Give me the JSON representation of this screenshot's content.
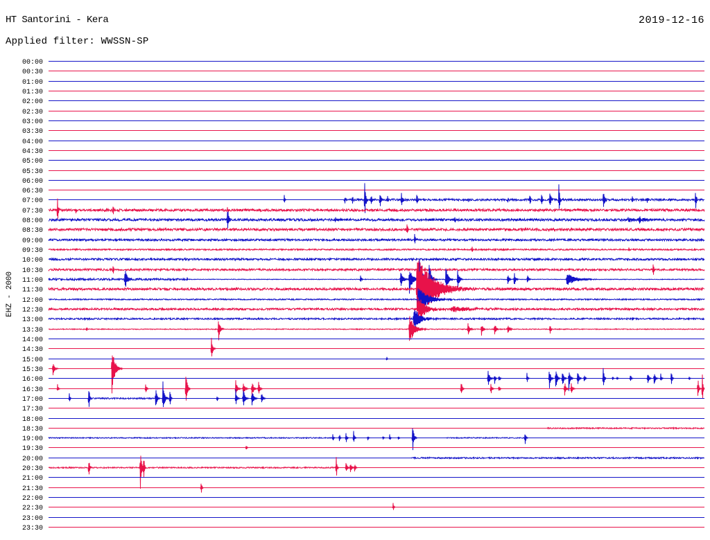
{
  "chart_data": {
    "type": "line",
    "title": "HT Santorini - Kera",
    "subtitle": "Applied filter: WWSSN-SP",
    "date": "2019-12-16",
    "ylabel": "EHZ - 2000",
    "xlim": [
      0,
      30
    ],
    "colors": [
      "#1212c8",
      "#e8124a"
    ],
    "traces": [
      {
        "label": "00:00",
        "noise": [],
        "events": []
      },
      {
        "label": "00:30",
        "noise": [],
        "events": []
      },
      {
        "label": "01:00",
        "noise": [],
        "events": []
      },
      {
        "label": "01:30",
        "noise": [],
        "events": []
      },
      {
        "label": "02:00",
        "noise": [],
        "events": []
      },
      {
        "label": "02:30",
        "noise": [],
        "events": []
      },
      {
        "label": "03:00",
        "noise": [],
        "events": []
      },
      {
        "label": "03:30",
        "noise": [],
        "events": []
      },
      {
        "label": "04:00",
        "noise": [],
        "events": []
      },
      {
        "label": "04:30",
        "noise": [],
        "events": []
      },
      {
        "label": "05:00",
        "noise": [],
        "events": []
      },
      {
        "label": "05:30",
        "noise": [],
        "events": []
      },
      {
        "label": "06:00",
        "noise": [],
        "events": []
      },
      {
        "label": "06:30",
        "noise": [],
        "events": []
      },
      {
        "label": "07:00",
        "noise": [
          [
            13.5,
            30,
            0.1
          ]
        ],
        "events": [
          [
            10.78,
            0.55,
            0.08
          ],
          [
            13.55,
            0.7,
            0.1
          ],
          [
            13.9,
            0.5,
            0.1
          ],
          [
            14.46,
            2.0,
            0.15
          ],
          [
            14.75,
            0.7,
            0.1
          ],
          [
            15.16,
            1.2,
            0.12
          ],
          [
            15.5,
            0.5,
            0.1
          ],
          [
            16.14,
            1.0,
            0.12
          ],
          [
            16.84,
            0.9,
            0.12
          ],
          [
            19.2,
            0.3,
            0.1
          ],
          [
            21.0,
            0.3,
            0.1
          ],
          [
            22.01,
            0.9,
            0.1
          ],
          [
            22.55,
            0.9,
            0.1
          ],
          [
            22.93,
            1.6,
            0.1
          ],
          [
            23.34,
            1.8,
            0.12
          ],
          [
            25.37,
            1.2,
            0.15
          ],
          [
            26.7,
            0.5,
            0.1
          ],
          [
            27.37,
            0.5,
            0.1
          ],
          [
            29.59,
            1.3,
            0.1
          ]
        ]
      },
      {
        "label": "07:30",
        "noise": [
          [
            0,
            30,
            0.12
          ]
        ],
        "events": [
          [
            0.41,
            2.0,
            0.08
          ],
          [
            1.24,
            0.5,
            0.1
          ],
          [
            2.95,
            0.7,
            0.1
          ],
          [
            8.18,
            0.6,
            0.1
          ]
        ]
      },
      {
        "label": "08:00",
        "noise": [
          [
            0,
            30,
            0.12
          ]
        ],
        "events": [
          [
            8.18,
            1.3,
            0.2
          ],
          [
            13.13,
            0.5,
            0.08
          ],
          [
            18.58,
            0.5,
            0.1
          ],
          [
            26.5,
            0.25,
            0.8
          ],
          [
            27.0,
            0.3,
            0.8
          ]
        ]
      },
      {
        "label": "08:30",
        "noise": [
          [
            0,
            30,
            0.12
          ]
        ],
        "events": [
          [
            16.39,
            0.8,
            0.12
          ]
        ]
      },
      {
        "label": "09:00",
        "noise": [
          [
            0,
            30,
            0.1
          ]
        ],
        "events": [
          [
            16.74,
            0.8,
            0.1
          ]
        ]
      },
      {
        "label": "09:30",
        "noise": [
          [
            0,
            30,
            0.07
          ]
        ],
        "events": [
          [
            19.37,
            0.5,
            0.08
          ],
          [
            26.54,
            0.3,
            0.08
          ]
        ]
      },
      {
        "label": "10:00",
        "noise": [
          [
            0,
            30,
            0.1
          ]
        ],
        "events": []
      },
      {
        "label": "10:30",
        "noise": [
          [
            0,
            30,
            0.1
          ]
        ],
        "events": [
          [
            2.95,
            0.7,
            0.1
          ],
          [
            27.65,
            1.0,
            0.1
          ]
        ]
      },
      {
        "label": "11:00",
        "noise": [
          [
            0,
            6.3,
            0.1
          ],
          [
            6.3,
            30,
            0.03
          ]
        ],
        "events": [
          [
            3.49,
            1.2,
            0.3
          ],
          [
            6.34,
            0.4,
            0.05
          ],
          [
            14.27,
            0.7,
            0.08
          ],
          [
            16.1,
            0.9,
            0.3
          ],
          [
            16.5,
            1.5,
            0.4
          ],
          [
            16.96,
            2.4,
            0.4
          ],
          [
            17.4,
            1.7,
            0.3
          ],
          [
            18.17,
            1.5,
            0.3
          ],
          [
            18.71,
            1.2,
            0.2
          ],
          [
            21.0,
            0.7,
            0.15
          ],
          [
            21.3,
            0.9,
            0.15
          ],
          [
            21.9,
            0.6,
            0.15
          ],
          [
            23.7,
            0.7,
            1.1
          ]
        ]
      },
      {
        "label": "11:30",
        "noise": [
          [
            0,
            30,
            0.12
          ]
        ],
        "events": [
          [
            16.84,
            3.8,
            2.0
          ]
        ]
      },
      {
        "label": "12:00",
        "noise": [
          [
            0,
            30,
            0.06
          ]
        ],
        "events": [
          [
            16.9,
            1.5,
            1.2
          ]
        ]
      },
      {
        "label": "12:30",
        "noise": [
          [
            0,
            30,
            0.1
          ]
        ],
        "events": [
          [
            16.9,
            1.4,
            1.0
          ],
          [
            18.4,
            0.3,
            2.5
          ]
        ]
      },
      {
        "label": "13:00",
        "noise": [
          [
            0,
            30,
            0.08
          ]
        ],
        "events": [
          [
            16.7,
            1.3,
            0.8
          ]
        ]
      },
      {
        "label": "13:30",
        "noise": [
          [
            0,
            30,
            0.04
          ]
        ],
        "events": [
          [
            1.74,
            0.3,
            0.1
          ],
          [
            7.77,
            1.4,
            0.2
          ],
          [
            16.5,
            1.6,
            0.6
          ],
          [
            19.18,
            0.8,
            0.2
          ],
          [
            19.8,
            0.7,
            0.2
          ],
          [
            20.4,
            0.7,
            0.2
          ],
          [
            21.0,
            0.6,
            0.2
          ],
          [
            22.93,
            0.8,
            0.1
          ]
        ]
      },
      {
        "label": "14:00",
        "noise": [],
        "events": []
      },
      {
        "label": "14:30",
        "noise": [],
        "events": [
          [
            7.45,
            1.4,
            0.15
          ]
        ]
      },
      {
        "label": "15:00",
        "noise": [],
        "events": [
          [
            15.47,
            0.3,
            0.05
          ]
        ]
      },
      {
        "label": "15:30",
        "noise": [],
        "events": [
          [
            0.2,
            0.8,
            0.2
          ],
          [
            2.9,
            2.6,
            0.35
          ]
        ]
      },
      {
        "label": "16:00",
        "noise": [],
        "events": [
          [
            20.1,
            1.1,
            0.2
          ],
          [
            20.4,
            0.7,
            0.1
          ],
          [
            20.6,
            0.5,
            0.1
          ],
          [
            21.88,
            0.6,
            0.1
          ],
          [
            22.9,
            1.3,
            0.15
          ],
          [
            23.2,
            1.5,
            0.15
          ],
          [
            23.5,
            1.2,
            0.15
          ],
          [
            23.8,
            1.4,
            0.15
          ],
          [
            24.2,
            1.0,
            0.15
          ],
          [
            24.5,
            0.7,
            0.1
          ],
          [
            25.37,
            1.9,
            0.1
          ],
          [
            25.8,
            0.3,
            0.08
          ],
          [
            26.0,
            0.3,
            0.08
          ],
          [
            26.61,
            0.6,
            0.1
          ],
          [
            27.4,
            0.8,
            0.15
          ],
          [
            27.7,
            0.8,
            0.15
          ],
          [
            28.0,
            0.6,
            0.1
          ],
          [
            28.48,
            1.0,
            0.1
          ],
          [
            29.3,
            0.3,
            0.08
          ]
        ]
      },
      {
        "label": "16:30",
        "noise": [],
        "events": [
          [
            0.41,
            0.5,
            0.1
          ],
          [
            4.44,
            0.9,
            0.1
          ],
          [
            6.28,
            2.4,
            0.15
          ],
          [
            8.56,
            0.9,
            0.2
          ],
          [
            8.9,
            0.8,
            0.2
          ],
          [
            9.3,
            1.0,
            0.2
          ],
          [
            9.6,
            0.9,
            0.15
          ],
          [
            18.87,
            1.1,
            0.12
          ],
          [
            20.23,
            0.8,
            0.12
          ],
          [
            20.6,
            0.5,
            0.1
          ],
          [
            23.6,
            1.0,
            0.15
          ],
          [
            23.9,
            0.8,
            0.15
          ],
          [
            29.7,
            1.6,
            0.1
          ],
          [
            29.9,
            1.8,
            0.1
          ]
        ]
      },
      {
        "label": "17:00",
        "noise": [
          [
            1.84,
            4.9,
            0.07
          ]
        ],
        "events": [
          [
            0.95,
            0.6,
            0.08
          ],
          [
            1.84,
            1.6,
            0.1
          ],
          [
            4.9,
            1.4,
            0.15
          ],
          [
            5.23,
            2.0,
            0.2
          ],
          [
            5.55,
            1.2,
            0.1
          ],
          [
            7.71,
            0.4,
            0.08
          ],
          [
            8.56,
            1.0,
            0.15
          ],
          [
            8.9,
            1.2,
            0.2
          ],
          [
            9.3,
            1.0,
            0.2
          ],
          [
            9.74,
            0.8,
            0.15
          ]
        ]
      },
      {
        "label": "17:30",
        "noise": [],
        "events": []
      },
      {
        "label": "18:00",
        "noise": [],
        "events": []
      },
      {
        "label": "18:30",
        "noise": [
          [
            22.8,
            30,
            0.06
          ]
        ],
        "events": []
      },
      {
        "label": "19:00",
        "noise": [
          [
            0,
            13,
            0.05
          ],
          [
            18.2,
            21.8,
            0.05
          ]
        ],
        "events": [
          [
            13.0,
            0.5,
            0.08
          ],
          [
            13.3,
            0.6,
            0.08
          ],
          [
            13.6,
            0.8,
            0.1
          ],
          [
            13.95,
            1.0,
            0.1
          ],
          [
            14.6,
            0.3,
            0.08
          ],
          [
            15.3,
            0.3,
            0.08
          ],
          [
            15.6,
            0.4,
            0.08
          ],
          [
            16.0,
            0.3,
            0.08
          ],
          [
            16.65,
            1.7,
            0.15
          ],
          [
            21.79,
            1.1,
            0.1
          ]
        ]
      },
      {
        "label": "19:30",
        "noise": [],
        "events": [
          [
            9.04,
            0.4,
            0.08
          ]
        ]
      },
      {
        "label": "20:00",
        "noise": [
          [
            16.6,
            30,
            0.07
          ]
        ],
        "events": []
      },
      {
        "label": "20:30",
        "noise": [
          [
            0,
            13.2,
            0.06
          ]
        ],
        "events": [
          [
            1.84,
            1.3,
            0.1
          ],
          [
            4.2,
            2.4,
            0.15
          ],
          [
            4.35,
            1.5,
            0.1
          ],
          [
            13.16,
            1.4,
            0.08
          ],
          [
            13.6,
            0.7,
            0.15
          ],
          [
            13.8,
            0.8,
            0.15
          ],
          [
            14.0,
            0.6,
            0.1
          ]
        ]
      },
      {
        "label": "21:00",
        "noise": [],
        "events": []
      },
      {
        "label": "21:30",
        "noise": [],
        "events": [
          [
            6.98,
            0.8,
            0.08
          ]
        ]
      },
      {
        "label": "22:00",
        "noise": [],
        "events": []
      },
      {
        "label": "22:30",
        "noise": [],
        "events": [
          [
            15.76,
            0.6,
            0.08
          ]
        ]
      },
      {
        "label": "23:00",
        "noise": [],
        "events": []
      },
      {
        "label": "23:30",
        "noise": [],
        "events": []
      }
    ]
  }
}
